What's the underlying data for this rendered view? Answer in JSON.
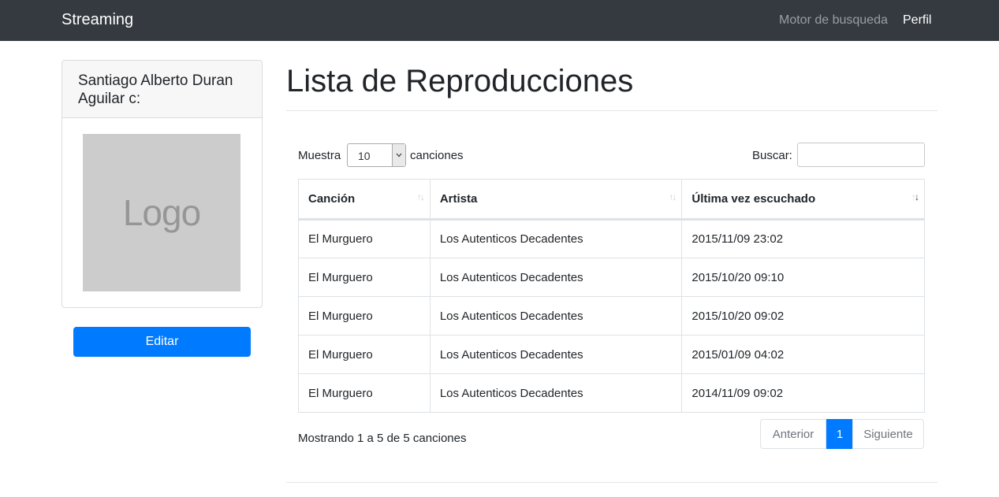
{
  "navbar": {
    "brand": "Streaming",
    "links": [
      "Motor de busqueda",
      "Perfil"
    ]
  },
  "profile": {
    "name": "Santiago Alberto Duran Aguilar c:",
    "logo_text": "Logo",
    "edit_label": "Editar"
  },
  "page": {
    "title": "Lista de Reproducciones"
  },
  "controls": {
    "length_prefix": "Muestra",
    "length_value": "10",
    "length_suffix": "canciones",
    "search_label": "Buscar:",
    "search_value": ""
  },
  "table": {
    "headers": [
      "Canción",
      "Artista",
      "Última vez escuchado"
    ],
    "sort_active_column": 2,
    "rows": [
      [
        "El Murguero",
        "Los Autenticos Decadentes",
        "2015/11/09 23:02"
      ],
      [
        "El Murguero",
        "Los Autenticos Decadentes",
        "2015/10/20 09:10"
      ],
      [
        "El Murguero",
        "Los Autenticos Decadentes",
        "2015/10/20 09:02"
      ],
      [
        "El Murguero",
        "Los Autenticos Decadentes",
        "2015/01/09 04:02"
      ],
      [
        "El Murguero",
        "Los Autenticos Decadentes",
        "2014/11/09 09:02"
      ]
    ]
  },
  "footer": {
    "info": "Mostrando 1 a 5 de 5 canciones",
    "prev": "Anterior",
    "current_page": "1",
    "next": "Siguiente"
  },
  "colors": {
    "navbar_bg": "#343a40",
    "primary": "#007bff"
  }
}
